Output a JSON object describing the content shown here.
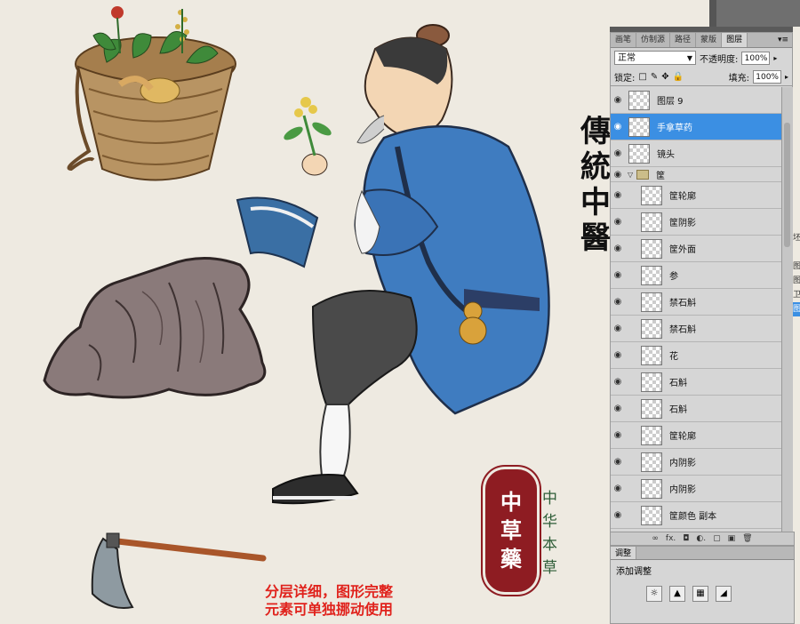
{
  "artwork": {
    "title_vertical": [
      "傳",
      "統",
      "中",
      "醫"
    ],
    "seal_chars": [
      "中",
      "草",
      "藥"
    ],
    "sub_vertical": [
      "中",
      "华",
      "本",
      "草"
    ],
    "caption_lines": [
      "分层详细，图形完整",
      "元素可单独挪动使用"
    ]
  },
  "layers_panel": {
    "tabs": [
      "画笔",
      "仿制源",
      "路径",
      "蒙版",
      "图层"
    ],
    "active_tab": "图层",
    "menu_icon": "panel-menu-icon",
    "blend_mode": "正常",
    "opacity_label": "不透明度:",
    "opacity_value": "100%",
    "lock_label": "锁定:",
    "fill_label": "填充:",
    "fill_value": "100%",
    "layers_top": [
      {
        "name": "图层 9",
        "selected": false
      },
      {
        "name": "手拿草药",
        "selected": true
      },
      {
        "name": "镜头",
        "selected": false
      }
    ],
    "group_name": "筐",
    "group_layers": [
      "筐轮廓",
      "筐阴影",
      "筐外面",
      "参",
      "禁石斛",
      "禁石斛",
      "花",
      "石斛",
      "石斛",
      "筐轮廓",
      "内阴影",
      "内阴影",
      "筐颜色 副本"
    ],
    "footer_icons": [
      "link-icon",
      "fx-icon",
      "mask-icon",
      "adjustment-icon",
      "folder-icon",
      "new-layer-icon",
      "trash-icon"
    ],
    "footer_glyphs": [
      "∞",
      "fx.",
      "◘",
      "◐.",
      "▢",
      "▣",
      "🗑"
    ]
  },
  "adjust_panel": {
    "tab": "调整",
    "title": "添加调整",
    "icon_glyphs": [
      "☼",
      "▲",
      "▦",
      "◢"
    ]
  },
  "edge_glyphs": [
    "坯",
    "",
    "图",
    "图",
    "卫",
    "图",
    "图"
  ]
}
